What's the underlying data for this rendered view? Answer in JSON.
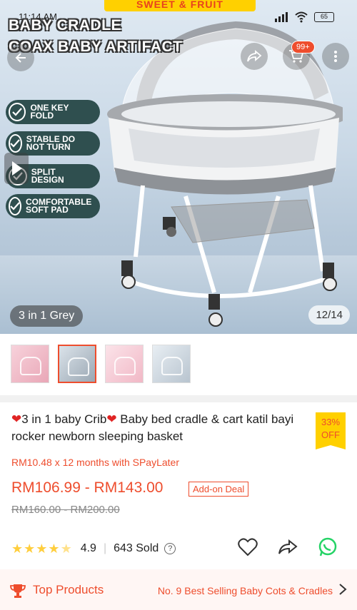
{
  "promo_banner": "SWEET & FRUIT",
  "status": {
    "time": "11:14 AM",
    "battery": "65"
  },
  "hero": {
    "title_line1": "BABY CRADLE",
    "title_line2": "COAX BABY ARTIFACT",
    "cart_count": "99+",
    "features": [
      "ONE KEY FOLD",
      "STABLE DO NOT TURN",
      "SPLIT DESIGN",
      "COMFORTABLE SOFT PAD"
    ],
    "variant_label": "3 in 1 Grey",
    "page_indicator": "12/14"
  },
  "product": {
    "title": "3 in 1 baby Crib",
    "title_rest": " Baby bed cradle & cart katil bayi rocker newborn sleeping basket",
    "discount_pct": "33%",
    "discount_label": "OFF",
    "installment": "RM10.48 x 12 months with SPayLater",
    "price_range": "RM106.99 - RM143.00",
    "addon_label": "Add-on Deal",
    "original_price": "RM160.00 - RM200.00",
    "rating": "4.9",
    "sold": "643 Sold"
  },
  "top_products": {
    "label": "Top Products",
    "rank": "No. 9 Best Selling Baby Cots & Cradles"
  },
  "colors": {
    "accent": "#ee4d2d",
    "star": "#ffce3d",
    "badge": "#ffd000",
    "whatsapp": "#25d366"
  }
}
